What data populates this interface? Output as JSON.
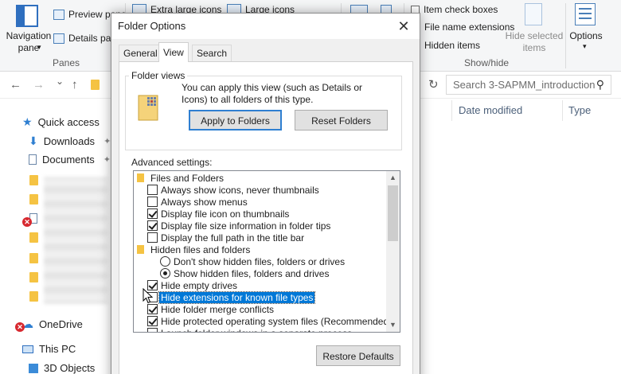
{
  "ribbon": {
    "navigation_pane": "Navigation\npane",
    "navigation_pane_arrow": "▾",
    "preview_pane": "Preview pane",
    "details_pane": "Details pane",
    "panes_group": "Panes",
    "extra_large_icons": "Extra large icons",
    "large_icons": "Large icons",
    "item_check_boxes": "Item check boxes",
    "file_name_extensions": "File name extensions",
    "hidden_items": "Hidden items",
    "hide_selected_items": "Hide selected\nitems",
    "options": "Options",
    "options_arrow": "▾",
    "show_hide_group": "Show/hide"
  },
  "navbar": {
    "back": "←",
    "forward": "→",
    "recent": "⌄",
    "up": "↑",
    "refresh": "↻",
    "search_placeholder": "Search 3-SAPMM_introduction"
  },
  "sidebar": {
    "quick_access": "Quick access",
    "downloads": "Downloads",
    "documents": "Documents",
    "onedrive": "OneDrive",
    "this_pc": "This PC",
    "objects_3d": "3D Objects"
  },
  "columns": {
    "date_modified": "Date modified",
    "type": "Type"
  },
  "dialog": {
    "title": "Folder Options",
    "close": "✕",
    "tabs": [
      "General",
      "View",
      "Search"
    ],
    "folder_views_label": "Folder views",
    "folder_views_text": "You can apply this view (such as Details or Icons) to all folders of this type.",
    "apply_button": "Apply to Folders",
    "reset_button": "Reset Folders",
    "advanced_label": "Advanced settings:",
    "settings": [
      {
        "kind": "folder",
        "label": "Files and Folders"
      },
      {
        "kind": "check",
        "checked": false,
        "label": "Always show icons, never thumbnails"
      },
      {
        "kind": "check",
        "checked": false,
        "label": "Always show menus"
      },
      {
        "kind": "check",
        "checked": true,
        "label": "Display file icon on thumbnails"
      },
      {
        "kind": "check",
        "checked": true,
        "label": "Display file size information in folder tips"
      },
      {
        "kind": "check",
        "checked": false,
        "label": "Display the full path in the title bar"
      },
      {
        "kind": "folder",
        "label": "Hidden files and folders"
      },
      {
        "kind": "radio",
        "checked": false,
        "label": "Don't show hidden files, folders or drives"
      },
      {
        "kind": "radio",
        "checked": true,
        "label": "Show hidden files, folders and drives"
      },
      {
        "kind": "check",
        "checked": true,
        "label": "Hide empty drives"
      },
      {
        "kind": "check",
        "checked": false,
        "label": "Hide extensions for known file types",
        "selected": true
      },
      {
        "kind": "check",
        "checked": true,
        "label": "Hide folder merge conflicts"
      },
      {
        "kind": "check",
        "checked": true,
        "label": "Hide protected operating system files (Recommended)"
      },
      {
        "kind": "check",
        "checked": false,
        "label": "Launch folder windows in a separate process"
      }
    ],
    "restore_button": "Restore Defaults"
  }
}
